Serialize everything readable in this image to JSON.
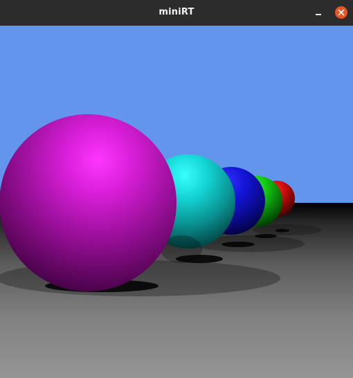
{
  "window": {
    "title": "miniRT"
  },
  "titlebar_buttons": {
    "minimize_icon": "minimize-icon",
    "close_icon": "close-icon",
    "close_color": "#e95420"
  },
  "scene": {
    "sky_color": "#6495ed",
    "floor_color": "#8f8f8f",
    "spheres": [
      {
        "name": "magenta-sphere",
        "color": "#ff20ff"
      },
      {
        "name": "cyan-sphere",
        "color": "#20ffff"
      },
      {
        "name": "blue-sphere",
        "color": "#2020ff"
      },
      {
        "name": "green-sphere",
        "color": "#20ff20"
      },
      {
        "name": "red-sphere",
        "color": "#ff2020"
      }
    ]
  }
}
